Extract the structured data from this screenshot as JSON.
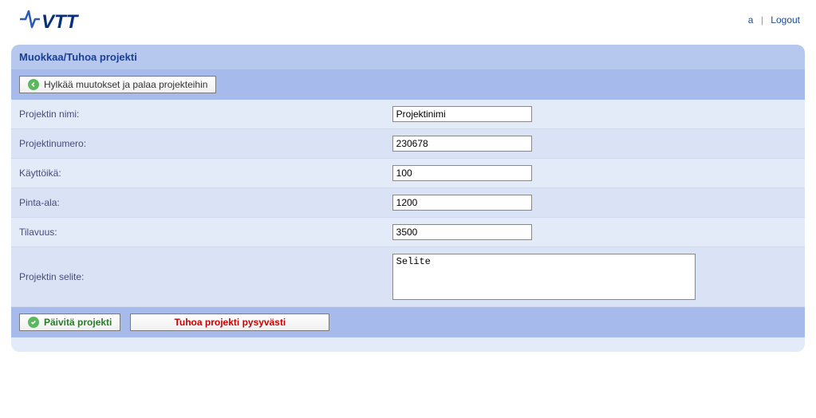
{
  "header": {
    "user_link": "a",
    "logout": "Logout"
  },
  "panel": {
    "title": "Muokkaa/Tuhoa projekti"
  },
  "toolbar": {
    "discard_label": "Hylkää muutokset ja palaa projekteihin"
  },
  "form": {
    "name": {
      "label": "Projektin nimi:",
      "value": "Projektinimi"
    },
    "number": {
      "label": "Projektinumero:",
      "value": "230678"
    },
    "lifespan": {
      "label": "Käyttöikä:",
      "value": "100"
    },
    "area": {
      "label": "Pinta-ala:",
      "value": "1200"
    },
    "volume": {
      "label": "Tilavuus:",
      "value": "3500"
    },
    "description": {
      "label": "Projektin selite:",
      "value": "Selite"
    }
  },
  "footer": {
    "update_label": "Päivitä projekti",
    "destroy_label": "Tuhoa projekti pysyvästi"
  }
}
